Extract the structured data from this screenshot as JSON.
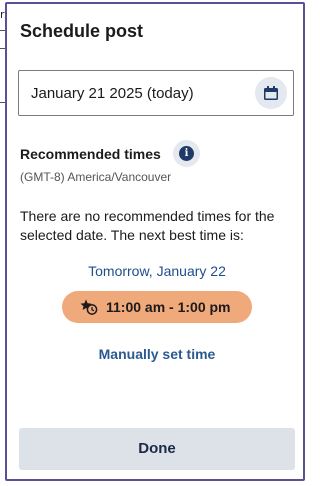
{
  "background": {
    "glyph": "r"
  },
  "dialog": {
    "title": "Schedule post",
    "date_field": {
      "value": "January 21 2025 (today)",
      "icon": "calendar-icon"
    },
    "recommended": {
      "heading": "Recommended times",
      "info_icon": "info-icon",
      "info_glyph": "i",
      "timezone": "(GMT-8) America/Vancouver"
    },
    "message": "There are no recommended times for the selected date. The next best time is:",
    "next_best": {
      "date": "Tomorrow, January 22",
      "time": "11:00 am - 1:00 pm",
      "icon": "star-clock-icon"
    },
    "manual_link": "Manually set time",
    "done_label": "Done"
  },
  "colors": {
    "accent_border": "#5b4f96",
    "link_blue": "#1f4e8c",
    "time_pill": "#f0a97a",
    "done_bg": "#dde1e8"
  }
}
